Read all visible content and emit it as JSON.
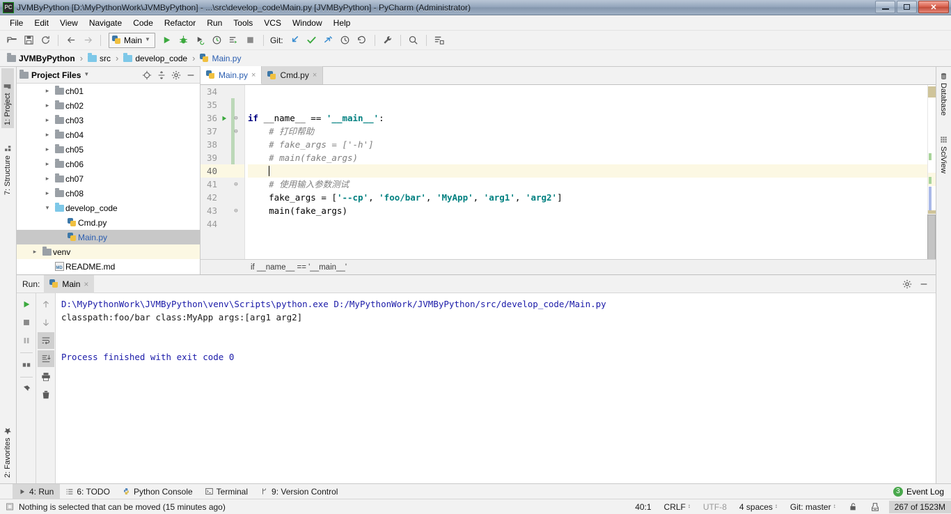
{
  "window": {
    "title": "JVMByPython [D:\\MyPythonWork\\JVMByPython] - ...\\src\\develop_code\\Main.py [JVMByPython] - PyCharm (Administrator)",
    "app_icon_label": "PC",
    "controls": {
      "minimize": "minimize-button",
      "restore": "restore-button",
      "close": "✕"
    }
  },
  "menubar": {
    "items": [
      "File",
      "Edit",
      "View",
      "Navigate",
      "Code",
      "Refactor",
      "Run",
      "Tools",
      "VCS",
      "Window",
      "Help"
    ]
  },
  "toolbar": {
    "icons": [
      "open-folder-icon",
      "save-all-icon",
      "sync-icon",
      "back-arrow-icon",
      "forward-arrow-icon"
    ],
    "run_config": {
      "name": "Main",
      "icon": "python-file-icon",
      "dropdown": "chevron-down-icon"
    },
    "run_icons": [
      "run-icon",
      "debug-icon",
      "run-coverage-icon",
      "profile-icon",
      "run-with-console-icon",
      "stop-icon"
    ],
    "git_label": "Git:",
    "git_icons": [
      "update-project-icon",
      "commit-icon",
      "push-icon",
      "history-icon",
      "rollback-icon"
    ],
    "tail_icons": [
      "settings-wrench-icon",
      "search-everywhere-icon",
      "structure-icon"
    ]
  },
  "breadcrumb": {
    "items": [
      {
        "label": "JVMByPython",
        "icon": "folder-icon",
        "style": "root"
      },
      {
        "label": "src",
        "icon": "folder-cyan-icon",
        "style": "normal"
      },
      {
        "label": "develop_code",
        "icon": "folder-cyan-icon",
        "style": "normal"
      },
      {
        "label": "Main.py",
        "icon": "python-file-icon",
        "style": "blue"
      }
    ],
    "separator": "›"
  },
  "left_tool_strip": {
    "tabs": [
      {
        "label": "1: Project",
        "icon": "project-icon",
        "selected": true
      },
      {
        "label": "7: Structure",
        "icon": "structure-icon",
        "selected": false
      },
      {
        "label": "2: Favorites",
        "icon": "star-icon",
        "selected": false
      }
    ]
  },
  "right_tool_strip": {
    "tabs": [
      {
        "label": "Database",
        "icon": "database-icon"
      },
      {
        "label": "SciView",
        "icon": "sciview-grid-icon"
      }
    ]
  },
  "project_panel": {
    "title": "Project Files",
    "dropdown": "chevron-down-icon",
    "actions": [
      "locate-target-icon",
      "collapse-all-icon",
      "settings-gear-icon",
      "hide-panel-icon"
    ],
    "tree": [
      {
        "label": "ch01",
        "icon": "folder-icon",
        "twisty": "›",
        "indent": 2,
        "state": "normal"
      },
      {
        "label": "ch02",
        "icon": "folder-icon",
        "twisty": "›",
        "indent": 2,
        "state": "normal"
      },
      {
        "label": "ch03",
        "icon": "folder-icon",
        "twisty": "›",
        "indent": 2,
        "state": "normal"
      },
      {
        "label": "ch04",
        "icon": "folder-icon",
        "twisty": "›",
        "indent": 2,
        "state": "normal"
      },
      {
        "label": "ch05",
        "icon": "folder-icon",
        "twisty": "›",
        "indent": 2,
        "state": "normal"
      },
      {
        "label": "ch06",
        "icon": "folder-icon",
        "twisty": "›",
        "indent": 2,
        "state": "normal"
      },
      {
        "label": "ch07",
        "icon": "folder-icon",
        "twisty": "›",
        "indent": 2,
        "state": "normal"
      },
      {
        "label": "ch08",
        "icon": "folder-icon",
        "twisty": "›",
        "indent": 2,
        "state": "normal"
      },
      {
        "label": "develop_code",
        "icon": "folder-cyan-icon",
        "twisty": "⌄",
        "indent": 2,
        "state": "normal"
      },
      {
        "label": "Cmd.py",
        "icon": "python-file-icon",
        "twisty": "",
        "indent": 3,
        "state": "normal"
      },
      {
        "label": "Main.py",
        "icon": "python-file-icon",
        "twisty": "",
        "indent": 3,
        "state": "selected"
      },
      {
        "label": "venv",
        "icon": "folder-icon",
        "twisty": "›",
        "indent": 1,
        "state": "highlighted"
      },
      {
        "label": "README.md",
        "icon": "markdown-file-icon",
        "twisty": "",
        "indent": 2,
        "state": "normal"
      }
    ]
  },
  "editor": {
    "tabs": [
      {
        "label": "Main.py",
        "icon": "python-file-icon",
        "active": true,
        "close": "×"
      },
      {
        "label": "Cmd.py",
        "icon": "python-file-icon",
        "active": false,
        "close": "×"
      }
    ],
    "first_line_number": 34,
    "current_line": 40,
    "lines": [
      {
        "n": 34,
        "tokens": []
      },
      {
        "n": 35,
        "tokens": []
      },
      {
        "n": 36,
        "run_marker": true,
        "fold": "⊖",
        "tokens": [
          {
            "t": "if ",
            "c": "kw"
          },
          {
            "t": "__name__ == ",
            "c": "pl"
          },
          {
            "t": "'__main__'",
            "c": "str"
          },
          {
            "t": ":",
            "c": "pl"
          }
        ]
      },
      {
        "n": 37,
        "fold": "⊖",
        "tokens": [
          {
            "t": "    # 打印帮助",
            "c": "cm"
          }
        ]
      },
      {
        "n": 38,
        "tokens": [
          {
            "t": "    # fake_args = ['-h']",
            "c": "cm"
          }
        ]
      },
      {
        "n": 39,
        "tokens": [
          {
            "t": "    # main(fake_args)",
            "c": "cm"
          }
        ]
      },
      {
        "n": 40,
        "current": true,
        "tokens": [
          {
            "t": "    ",
            "c": "pl"
          }
        ]
      },
      {
        "n": 41,
        "fold": "⊖",
        "tokens": [
          {
            "t": "    # 使用输入参数测试",
            "c": "cm"
          }
        ]
      },
      {
        "n": 42,
        "tokens": [
          {
            "t": "    fake_args = [",
            "c": "pl"
          },
          {
            "t": "'--cp'",
            "c": "str"
          },
          {
            "t": ", ",
            "c": "pl"
          },
          {
            "t": "'foo/bar'",
            "c": "str"
          },
          {
            "t": ", ",
            "c": "pl"
          },
          {
            "t": "'MyApp'",
            "c": "str"
          },
          {
            "t": ", ",
            "c": "pl"
          },
          {
            "t": "'arg1'",
            "c": "str"
          },
          {
            "t": ", ",
            "c": "pl"
          },
          {
            "t": "'arg2'",
            "c": "str"
          },
          {
            "t": "]",
            "c": "pl"
          }
        ]
      },
      {
        "n": 43,
        "fold": "⊖",
        "tokens": [
          {
            "t": "    main(fake_args)",
            "c": "pl"
          }
        ]
      },
      {
        "n": 44,
        "tokens": []
      }
    ],
    "breadcrumb_text": "if __name__ == '__main__'"
  },
  "run_panel": {
    "label": "Run:",
    "tab": {
      "label": "Main",
      "icon": "python-file-icon",
      "close": "×"
    },
    "header_actions": [
      "settings-gear-icon",
      "hide-panel-icon"
    ],
    "side_buttons_left": [
      "rerun-icon",
      "stop-icon",
      "pause-icon",
      "restore-layout-icon",
      "pin-tab-icon"
    ],
    "side_buttons_right": [
      "scroll-up-icon",
      "scroll-down-icon",
      "soft-wrap-icon",
      "scroll-to-end-icon",
      "print-icon",
      "clear-all-icon"
    ],
    "console_lines": [
      {
        "text": "D:\\MyPythonWork\\JVMByPython\\venv\\Scripts\\python.exe D:/MyPythonWork/JVMByPython/src/develop_code/Main.py",
        "color": "blue"
      },
      {
        "text": "classpath:foo/bar class:MyApp args:[arg1 arg2]",
        "color": "black"
      },
      {
        "text": "",
        "color": "black"
      },
      {
        "text": "",
        "color": "black"
      },
      {
        "text": "Process finished with exit code 0",
        "color": "blue"
      }
    ]
  },
  "bottom_tabs": {
    "items": [
      {
        "label": "4: Run",
        "accesskey": "4",
        "icon": "run-triangle-icon",
        "selected": true
      },
      {
        "label": "6: TODO",
        "accesskey": "6",
        "icon": "todo-list-icon",
        "selected": false
      },
      {
        "label": "Python Console",
        "accesskey": "",
        "icon": "python-console-icon",
        "selected": false
      },
      {
        "label": "Terminal",
        "accesskey": "",
        "icon": "terminal-icon",
        "selected": false
      },
      {
        "label": "9: Version Control",
        "accesskey": "9",
        "icon": "branch-icon",
        "selected": false
      }
    ],
    "event_log": {
      "label": "Event Log",
      "count": "3"
    }
  },
  "status_bar": {
    "message": "Nothing is selected that can be moved (15 minutes ago)",
    "message_icon": "widget-icon",
    "caret_position": "40:1",
    "line_separator": "CRLF",
    "encoding": "UTF-8",
    "indent": "4 spaces",
    "git_branch": "Git: master",
    "lock_icon": "unlocked-icon",
    "inspection_icon": "inspections-icon",
    "memory": "267 of 1523M"
  },
  "colors": {
    "accent_blue": "#2a5db0",
    "run_green": "#49a84c",
    "string_teal": "#008080",
    "keyword_navy": "#000080",
    "comment_gray": "#808080",
    "current_line": "#fcf8e3",
    "selection_gray": "#c8c8c8",
    "console_blue": "#1a1aa8",
    "changebar_green": "#bcd8b8"
  }
}
